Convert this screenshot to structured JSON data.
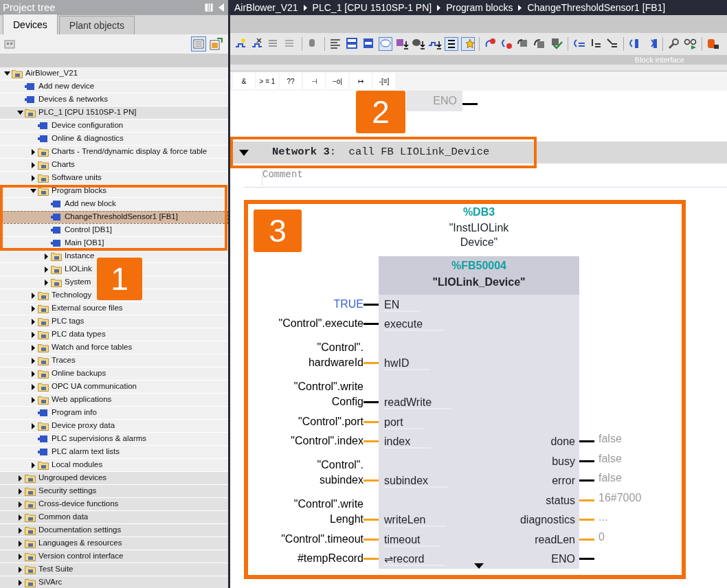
{
  "project_tree": {
    "title": "Project tree",
    "tabs": [
      {
        "label": "Devices",
        "selected": true
      },
      {
        "label": "Plant objects",
        "selected": false
      }
    ],
    "items": [
      {
        "label": "AirBlower_V21",
        "expanded": true,
        "selected": false,
        "children": [
          {
            "label": "Add new device",
            "selected": false
          },
          {
            "label": "Devices & networks",
            "selected": false
          },
          {
            "label": "PLC_1 [CPU 1510SP-1 PN]",
            "expanded": true,
            "selected": false,
            "children": [
              {
                "label": "Device configuration",
                "selected": false
              },
              {
                "label": "Online & diagnostics",
                "selected": false
              },
              {
                "label": "Charts - Trend/dynamic display & force table",
                "expanded": false,
                "selected": false
              },
              {
                "label": "Charts",
                "expanded": false,
                "selected": false
              },
              {
                "label": "Software units",
                "expanded": false,
                "selected": false
              },
              {
                "label": "Program blocks",
                "expanded": true,
                "selected": false,
                "children": [
                  {
                    "label": "Add new block",
                    "selected": false
                  },
                  {
                    "label": "ChangeThresholdSensor1 [FB1]",
                    "selected": true
                  },
                  {
                    "label": "Control [DB1]",
                    "selected": false
                  },
                  {
                    "label": "Main [OB1]",
                    "selected": false
                  },
                  {
                    "label": "Instance",
                    "expanded": false,
                    "selected": false
                  },
                  {
                    "label": "LIOLink",
                    "expanded": false,
                    "selected": false
                  },
                  {
                    "label": "System",
                    "expanded": false,
                    "selected": false
                  }
                ]
              },
              {
                "label": "Technology",
                "expanded": false,
                "selected": false
              },
              {
                "label": "External source files",
                "expanded": false,
                "selected": false
              },
              {
                "label": "PLC tags",
                "expanded": false,
                "selected": false
              },
              {
                "label": "PLC data types",
                "expanded": false,
                "selected": false
              },
              {
                "label": "Watch and force tables",
                "expanded": false,
                "selected": false
              },
              {
                "label": "Traces",
                "expanded": false,
                "selected": false
              },
              {
                "label": "Online backups",
                "expanded": false,
                "selected": false
              },
              {
                "label": "OPC UA communication",
                "expanded": false,
                "selected": false
              },
              {
                "label": "Web applications",
                "expanded": false,
                "selected": false
              },
              {
                "label": "Program info",
                "selected": false
              },
              {
                "label": "Device proxy data",
                "expanded": false,
                "selected": false
              },
              {
                "label": "PLC supervisions & alarms",
                "selected": false
              },
              {
                "label": "PLC alarm text lists",
                "selected": false
              },
              {
                "label": "Local modules",
                "expanded": false,
                "selected": false
              }
            ]
          },
          {
            "label": "Ungrouped devices",
            "expanded": false,
            "selected": false
          },
          {
            "label": "Security settings",
            "expanded": false,
            "selected": false
          },
          {
            "label": "Cross-device functions",
            "expanded": false,
            "selected": false
          },
          {
            "label": "Common data",
            "expanded": false,
            "selected": false
          },
          {
            "label": "Documentation settings",
            "expanded": false,
            "selected": false
          },
          {
            "label": "Languages & resources",
            "expanded": false,
            "selected": false
          },
          {
            "label": "Version control interface",
            "expanded": false,
            "selected": false
          },
          {
            "label": "Test Suite",
            "expanded": false,
            "selected": false
          },
          {
            "label": "SiVArc",
            "expanded": false,
            "selected": false
          }
        ]
      }
    ]
  },
  "editor": {
    "breadcrumb": [
      "AirBlower_V21",
      "PLC_1 [CPU 1510SP-1 PN]",
      "Program blocks",
      "ChangeThresholdSensor1 [FB1]"
    ],
    "toolbar_caption": "Block interface",
    "instructions": [
      "&",
      "> = 1",
      "??",
      "⊣",
      "−o|",
      "↦",
      "-[=]"
    ],
    "previous_output": "ENO",
    "network": {
      "title": "**Network 3**:  call FB LIOLink_Device",
      "comment": "Comment"
    },
    "block": {
      "instance_address": "%DB3",
      "instance_name": "\"InstLIOLink\nDevice\"",
      "address": "%FB50004",
      "name": "\"LIOLink_Device\"",
      "inputs": [
        {
          "operand": "TRUE",
          "name": "EN",
          "kind": "bool",
          "literal": true
        },
        {
          "operand": "\"Control\".execute",
          "name": "execute",
          "kind": "bool",
          "literal": false
        },
        {
          "operand": "\"Control\".\nhardwareId",
          "name": "hwID",
          "kind": "data",
          "literal": false
        },
        {
          "operand": "\"Control\".write\nConfig",
          "name": "readWrite",
          "kind": "bool",
          "literal": false
        },
        {
          "operand": "\"Control\".port",
          "name": "port",
          "kind": "data",
          "literal": false
        },
        {
          "operand": "\"Control\".index",
          "name": "index",
          "kind": "data",
          "literal": false
        },
        {
          "operand": "\"Control\".\nsubindex",
          "name": "subindex",
          "kind": "data",
          "literal": false
        },
        {
          "operand": "\"Control\".write\nLenght",
          "name": "writeLen",
          "kind": "data",
          "literal": false
        },
        {
          "operand": "\"Control\".timeout",
          "name": "timeout",
          "kind": "data",
          "literal": false
        },
        {
          "operand": "#tempRecord",
          "name": "⇌record",
          "kind": "data",
          "literal": false
        }
      ],
      "outputs": [
        {
          "name": "done",
          "value": "false",
          "kind": "bool"
        },
        {
          "name": "busy",
          "value": "false",
          "kind": "bool"
        },
        {
          "name": "error",
          "value": "false",
          "kind": "bool"
        },
        {
          "name": "status",
          "value": "16#7000",
          "kind": "data"
        },
        {
          "name": "diagnostics",
          "value": "...",
          "kind": "data"
        },
        {
          "name": "readLen",
          "value": "0",
          "kind": "data"
        },
        {
          "name": "ENO",
          "kind": "bool"
        }
      ]
    }
  },
  "callouts": [
    "1",
    "2",
    "3"
  ]
}
